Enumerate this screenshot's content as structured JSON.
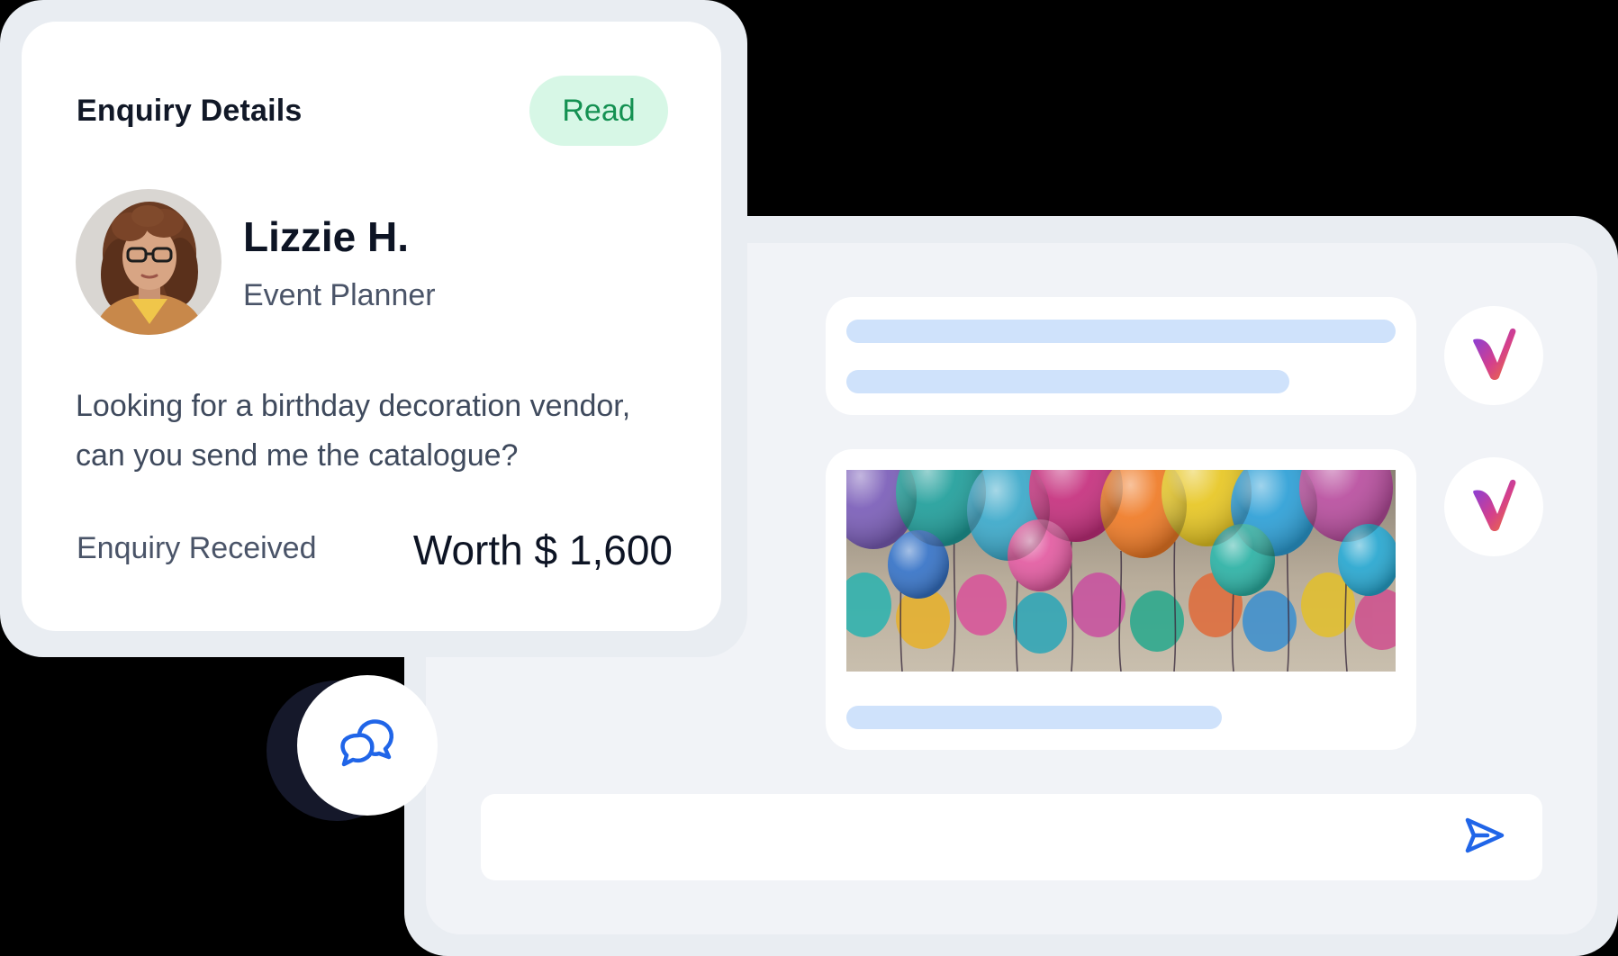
{
  "enquiry": {
    "title": "Enquiry Details",
    "status": "Read",
    "name": "Lizzie H.",
    "role": "Event Planner",
    "message": "Looking for a birthday decoration vendor, can you send me the catalogue?",
    "received_label": "Enquiry Received",
    "worth": "Worth $ 1,600"
  },
  "icons": {
    "send": "send-icon",
    "chat": "chat-bubbles-icon",
    "brand": "brand-logo-icon"
  },
  "colors": {
    "status_bg": "#d7f7e6",
    "status_text": "#149152",
    "skeleton": "#cfe2fb",
    "accent_blue": "#2065e8"
  }
}
